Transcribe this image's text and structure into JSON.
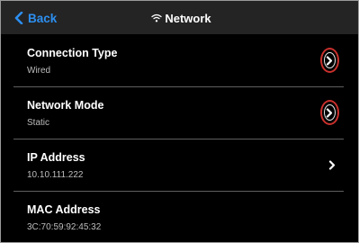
{
  "header": {
    "back_label": "Back",
    "title": "Network",
    "back_icon": "chevron-left-icon",
    "title_icon": "wifi-icon"
  },
  "settings": [
    {
      "label": "Connection Type",
      "value": "Wired",
      "has_chevron": true,
      "highlighted": true
    },
    {
      "label": "Network Mode",
      "value": "Static",
      "has_chevron": true,
      "highlighted": true
    },
    {
      "label": "IP Address",
      "value": "10.10.111.222",
      "has_chevron": true,
      "highlighted": false
    },
    {
      "label": "MAC Address",
      "value": "3C:70:59:92:45:32",
      "has_chevron": false,
      "highlighted": false
    }
  ],
  "colors": {
    "background": "#000000",
    "header": "#242424",
    "accent": "#2d8ff0",
    "divider": "#5f5f5f",
    "highlight_ring": "#c9302c"
  }
}
